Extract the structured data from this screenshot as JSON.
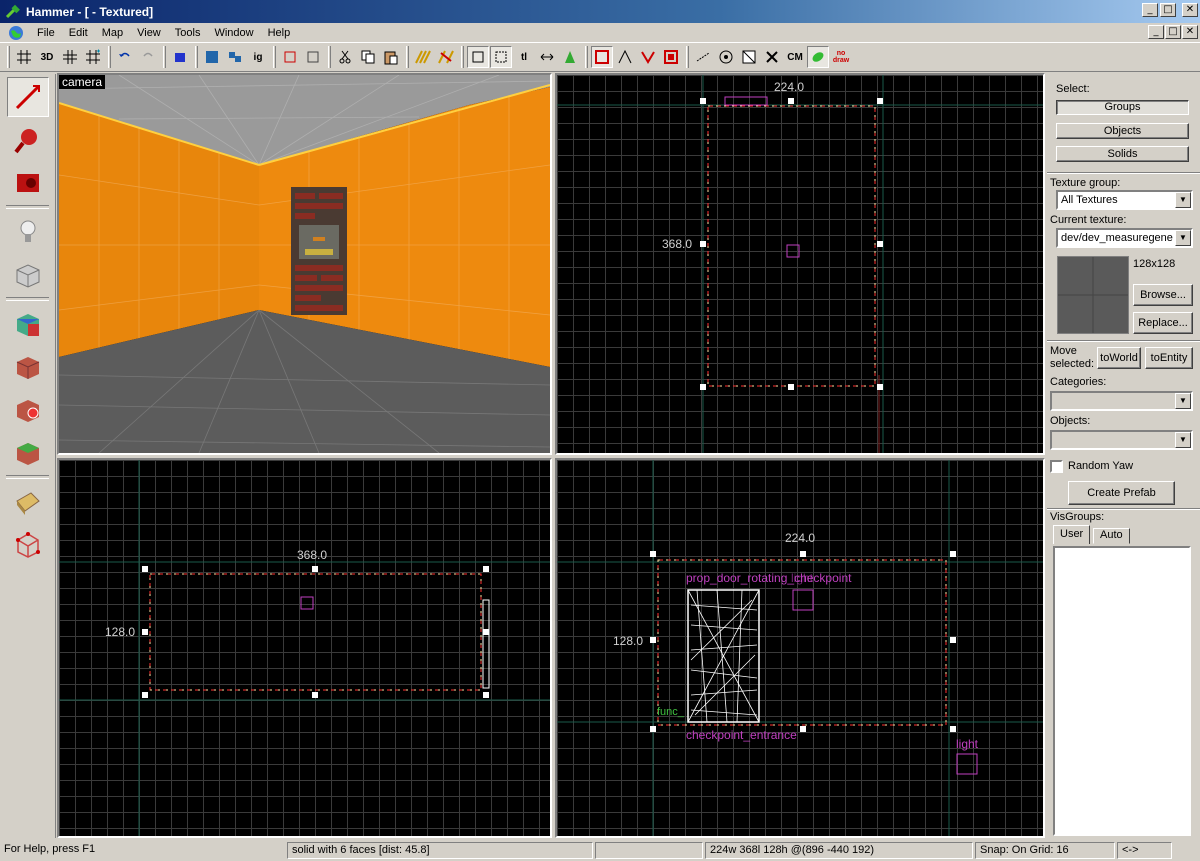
{
  "window": {
    "title": "Hammer - [ - Textured]",
    "controls": [
      "_",
      "□",
      "✕"
    ]
  },
  "menu": [
    {
      "label": "File",
      "accel": "F"
    },
    {
      "label": "Edit",
      "accel": "E"
    },
    {
      "label": "Map",
      "accel": "M"
    },
    {
      "label": "View",
      "accel": "V"
    },
    {
      "label": "Tools",
      "accel": "T"
    },
    {
      "label": "Window",
      "accel": "W"
    },
    {
      "label": "Help",
      "accel": "H"
    }
  ],
  "toolbar": {
    "grid_3d": "3D",
    "ig": "ig",
    "tl": "tl",
    "cm": "CM",
    "nodraw": "no draw"
  },
  "viewports": {
    "camera_label": "camera",
    "top": {
      "width_label": "224.0",
      "height_label": "368.0"
    },
    "side": {
      "width_label": "368.0",
      "height_label": "128.0"
    },
    "front": {
      "width_label": "224.0",
      "height_label": "128.0",
      "entity_door": "prop_door_rotating_checkpoint",
      "entity_light1": "light",
      "entity_func": "func_",
      "entity_entrance": "checkpoint_entrance",
      "entity_light2": "light"
    }
  },
  "panel": {
    "select_label": "Select:",
    "groups_btn": "Groups",
    "objects_btn": "Objects",
    "solids_btn": "Solids",
    "texture_group_label": "Texture group:",
    "texture_group_value": "All Textures",
    "current_texture_label": "Current texture:",
    "current_texture_value": "dev/dev_measuregene",
    "texture_size": "128x128",
    "browse_btn": "Browse...",
    "replace_btn": "Replace...",
    "move_selected_label": "Move selected:",
    "to_world_btn": "toWorld",
    "to_entity_btn": "toEntity",
    "categories_label": "Categories:",
    "objects_label": "Objects:",
    "random_yaw_label": "Random Yaw",
    "create_prefab_btn": "Create Prefab",
    "visgroups_label": "VisGroups:",
    "tab_user": "User",
    "tab_auto": "Auto"
  },
  "status": {
    "help": "For Help, press F1",
    "selection": "solid with 6 faces   [dist: 45.8]",
    "dimensions": "224w 368l 128h @(896 -440 192)",
    "snap": "Snap: On Grid: 16",
    "nav": "<->"
  },
  "colors": {
    "wall": "#e8860c",
    "floor": "#5c5c5c",
    "selection": "#ff3030",
    "entity": "#c040c0"
  }
}
